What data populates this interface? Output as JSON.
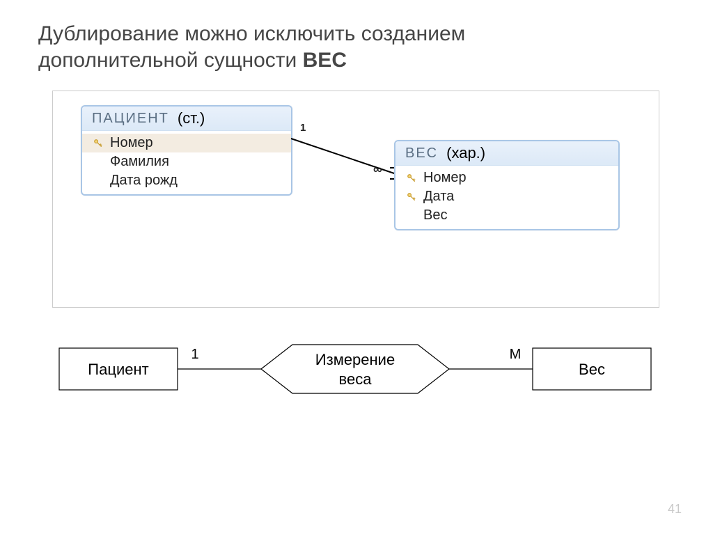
{
  "title": {
    "line1": "Дублирование можно исключить созданием",
    "line2_pre": "дополнительной сущности ",
    "line2_bold": "ВЕС"
  },
  "panel": {
    "patient": {
      "name": "ПАЦИЕНТ",
      "annotation": "(ст.)",
      "rows": [
        {
          "key": true,
          "label": "Номер",
          "selected": true
        },
        {
          "key": false,
          "label": "Фамилия",
          "selected": false
        },
        {
          "key": false,
          "label": "Дата рожд",
          "selected": false
        }
      ]
    },
    "weight": {
      "name": "ВЕС",
      "annotation": "(хар.)",
      "rows": [
        {
          "key": true,
          "label": "Номер",
          "selected": false
        },
        {
          "key": true,
          "label": "Дата",
          "selected": false
        },
        {
          "key": false,
          "label": "Вес",
          "selected": false
        }
      ]
    },
    "relation": {
      "left_card": "1",
      "right_card": "∞"
    }
  },
  "er": {
    "left": "Пациент",
    "rel_l1": "Измерение",
    "rel_l2": "веса",
    "right": "Вес",
    "card_left": "1",
    "card_right": "М"
  },
  "page_number": "41"
}
